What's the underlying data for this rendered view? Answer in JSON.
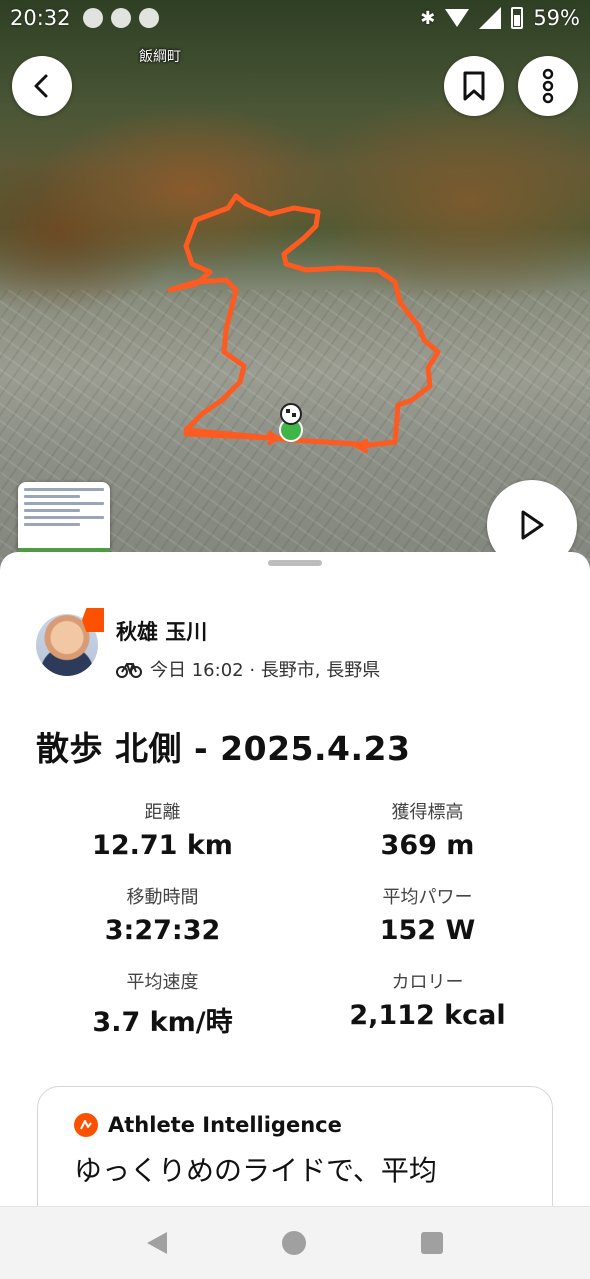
{
  "status_bar": {
    "time": "20:32",
    "battery": "59%",
    "icons": [
      "facebook-icon",
      "messenger-icon",
      "image-icon",
      "bluetooth-icon",
      "wifi-icon",
      "signal-icon",
      "battery-icon"
    ]
  },
  "map": {
    "town_label": "飯綱町",
    "route_color": "#fc5200",
    "start_marker_color": "#3fb54a"
  },
  "athlete": {
    "name": "秋雄 玉川",
    "meta": "今日 16:02 · 長野市, 長野県",
    "activity_icon": "bike-icon"
  },
  "activity": {
    "title": "散歩 北側 - 2025.4.23"
  },
  "stats": [
    {
      "label": "距離",
      "value": "12.71 km"
    },
    {
      "label": "獲得標高",
      "value": "369 m"
    },
    {
      "label": "移動時間",
      "value": "3:27:32"
    },
    {
      "label": "平均パワー",
      "value": "152 W"
    },
    {
      "label": "平均速度",
      "value": "3.7 km/時"
    },
    {
      "label": "カロリー",
      "value": "2,112 kcal"
    }
  ],
  "athlete_intelligence": {
    "title": "Athlete Intelligence",
    "text": "ゆっくりめのライドで、平均"
  },
  "colors": {
    "accent": "#fc5200"
  }
}
